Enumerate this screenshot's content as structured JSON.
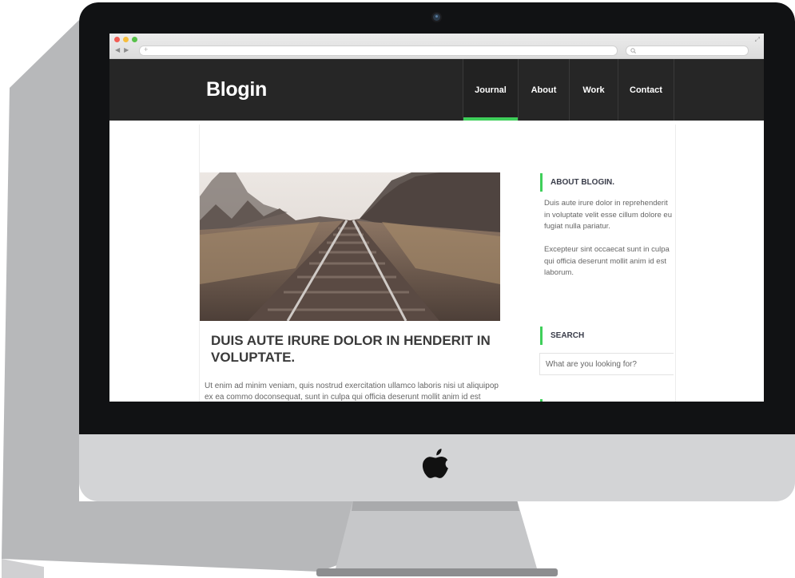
{
  "site": {
    "logo": "Blogin"
  },
  "nav": {
    "items": [
      {
        "label": "Journal",
        "active": true
      },
      {
        "label": "About",
        "active": false
      },
      {
        "label": "Work",
        "active": false
      },
      {
        "label": "Contact",
        "active": false
      }
    ]
  },
  "post": {
    "title": "DUIS AUTE IRURE DOLOR IN HENDERIT IN VOLUPTATE.",
    "excerpt": "Ut enim ad minim veniam, quis nostrud exercitation ullamco laboris nisi ut aliquipop ex ea commo doconsequat, sunt in culpa qui officia deserunt mollit anim id est laborum.",
    "image_icon": "railway-photo"
  },
  "sidebar": {
    "about": {
      "title": "ABOUT BLOGIN.",
      "paragraphs": [
        "Duis aute irure dolor in reprehenderit in voluptate velit esse cillum dolore eu fugiat nulla pariatur.",
        "Excepteur sint occaecat sunt in culpa qui officia deserunt mollit anim id est laborum."
      ]
    },
    "search": {
      "title": "SEARCH",
      "placeholder": "What are you looking for?"
    }
  },
  "colors": {
    "accent": "#3fcf5a",
    "header_bg": "#262626",
    "bezel": "#111214",
    "chin": "#d3d4d6"
  }
}
